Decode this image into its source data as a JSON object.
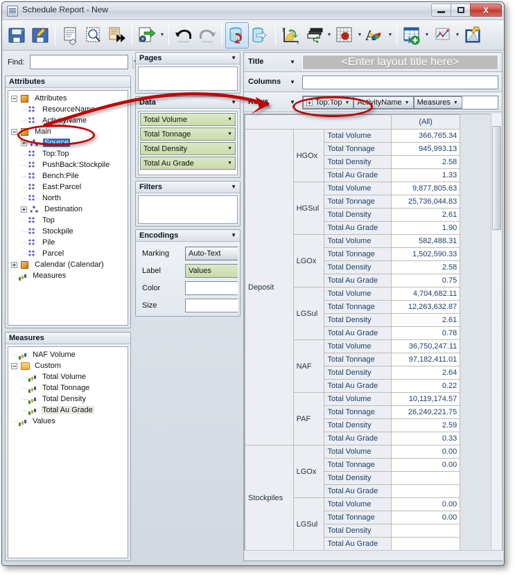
{
  "window": {
    "title": "Schedule Report - New",
    "app_icon": "report-window-icon",
    "minimize_label": "Minimize",
    "maximize_label": "Maximize",
    "close_label": "X"
  },
  "toolbar": {
    "buttons": [
      {
        "name": "save-icon",
        "label": "Save"
      },
      {
        "name": "save-as-icon",
        "label": "Save As"
      },
      {
        "name": "sep1",
        "label": ""
      },
      {
        "name": "clear-layout-icon",
        "label": "Clear Layout"
      },
      {
        "name": "preview-icon",
        "label": "Print Preview"
      },
      {
        "name": "export-sheet-icon",
        "label": "Export Sheet"
      },
      {
        "name": "sep2",
        "label": ""
      },
      {
        "name": "export-settings-icon",
        "label": "Export Settings"
      },
      {
        "name": "sep3",
        "label": ""
      },
      {
        "name": "undo-icon",
        "label": "Undo"
      },
      {
        "name": "redo-icon",
        "label": "Redo"
      },
      {
        "name": "sep4",
        "label": ""
      },
      {
        "name": "refresh-data-icon",
        "label": "Refresh Data"
      },
      {
        "name": "export-data-icon",
        "label": "Export Data"
      },
      {
        "name": "sep5",
        "label": ""
      },
      {
        "name": "axis-settings-icon",
        "label": "Axis Settings"
      },
      {
        "name": "layers-icon",
        "label": "Layers"
      },
      {
        "name": "grid-settings-icon",
        "label": "Grid Settings"
      },
      {
        "name": "font-color-icon",
        "label": "Font and Color"
      },
      {
        "name": "sep6",
        "label": ""
      },
      {
        "name": "add-table-icon",
        "label": "Add Table"
      },
      {
        "name": "add-chart-icon",
        "label": "Add Chart"
      },
      {
        "name": "new-layout-icon",
        "label": "New Layout"
      }
    ]
  },
  "find": {
    "label": "Find:",
    "value": "",
    "placeholder": ""
  },
  "attributes_panel": {
    "title": "Attributes",
    "nodes": [
      {
        "label": "Attributes",
        "depth": 0,
        "expander": "minus",
        "icon": "cube-icon",
        "state": "normal"
      },
      {
        "label": "ResourceName",
        "depth": 1,
        "expander": "leaf",
        "icon": "attribute-icon",
        "state": "normal"
      },
      {
        "label": "ActivityName",
        "depth": 1,
        "expander": "leaf",
        "icon": "attribute-icon",
        "state": "normal"
      },
      {
        "label": "Main",
        "depth": 0,
        "expander": "minus",
        "icon": "cube-icon",
        "state": "normal"
      },
      {
        "label": "Source",
        "depth": 1,
        "expander": "plus",
        "icon": "hierarchy-icon",
        "state": "selected"
      },
      {
        "label": "Top:Top",
        "depth": 1,
        "expander": "leaf",
        "icon": "attribute-icon",
        "state": "normal"
      },
      {
        "label": "PushBack:Stockpile",
        "depth": 1,
        "expander": "leaf",
        "icon": "attribute-icon",
        "state": "normal"
      },
      {
        "label": "Bench:Pile",
        "depth": 1,
        "expander": "leaf",
        "icon": "attribute-icon",
        "state": "normal"
      },
      {
        "label": "East:Parcel",
        "depth": 1,
        "expander": "leaf",
        "icon": "attribute-icon",
        "state": "normal"
      },
      {
        "label": "North",
        "depth": 1,
        "expander": "leaf",
        "icon": "attribute-icon",
        "state": "normal"
      },
      {
        "label": "Destination",
        "depth": 1,
        "expander": "plus",
        "icon": "hierarchy-icon",
        "state": "normal"
      },
      {
        "label": "Top",
        "depth": 1,
        "expander": "leaf",
        "icon": "attribute-icon",
        "state": "normal"
      },
      {
        "label": "Stockpile",
        "depth": 1,
        "expander": "leaf",
        "icon": "attribute-icon",
        "state": "normal"
      },
      {
        "label": "Pile",
        "depth": 1,
        "expander": "leaf",
        "icon": "attribute-icon",
        "state": "normal"
      },
      {
        "label": "Parcel",
        "depth": 1,
        "expander": "leaf",
        "icon": "attribute-icon",
        "state": "normal"
      },
      {
        "label": "Calendar (Calendar)",
        "depth": 0,
        "expander": "plus",
        "icon": "cube-icon",
        "state": "normal"
      },
      {
        "label": "Measures",
        "depth": 0,
        "expander": "leaf",
        "icon": "measures-icon",
        "state": "normal"
      }
    ]
  },
  "measures_panel": {
    "title": "Measures",
    "nodes": [
      {
        "label": "NAF Volume",
        "depth": 0,
        "expander": "leaf",
        "icon": "measure-icon",
        "state": "normal"
      },
      {
        "label": "Custom",
        "depth": 0,
        "expander": "minus",
        "icon": "folder-icon",
        "state": "normal"
      },
      {
        "label": "Total Volume",
        "depth": 1,
        "expander": "leaf",
        "icon": "measure-icon",
        "state": "normal"
      },
      {
        "label": "Total Tonnage",
        "depth": 1,
        "expander": "leaf",
        "icon": "measure-icon",
        "state": "normal"
      },
      {
        "label": "Total Density",
        "depth": 1,
        "expander": "leaf",
        "icon": "calc-measure-icon",
        "state": "normal"
      },
      {
        "label": "Total Au Grade",
        "depth": 1,
        "expander": "leaf",
        "icon": "calc-measure-icon",
        "state": "highlighted"
      },
      {
        "label": "Values",
        "depth": 0,
        "expander": "leaf",
        "icon": "measure-icon",
        "state": "normal"
      }
    ]
  },
  "pages_panel": {
    "title": "Pages",
    "collapse_icon": "chevron-down-icon",
    "items": []
  },
  "data_panel": {
    "title": "Data",
    "collapse_icon": "chevron-down-icon",
    "items": [
      {
        "label": "Total Volume",
        "dropdown_icon": "chevron-down-icon"
      },
      {
        "label": "Total Tonnage",
        "dropdown_icon": "chevron-down-icon"
      },
      {
        "label": "Total Density",
        "dropdown_icon": "chevron-down-icon"
      },
      {
        "label": "Total Au Grade",
        "dropdown_icon": "chevron-down-icon"
      }
    ]
  },
  "filters_panel": {
    "title": "Filters",
    "collapse_icon": "chevron-down-icon",
    "items": []
  },
  "encodings_panel": {
    "title": "Encodings",
    "collapse_icon": "chevron-down-icon",
    "rows": [
      {
        "label": "Marking",
        "value": "Auto-Text",
        "style": "button",
        "dropdown_icon": "chevron-down-icon"
      },
      {
        "label": "Label",
        "value": "Values",
        "style": "green",
        "dropdown_icon": "chevron-down-icon"
      },
      {
        "label": "Color",
        "value": "",
        "style": "empty",
        "dropdown_icon": ""
      },
      {
        "label": "Size",
        "value": "",
        "style": "empty",
        "dropdown_icon": ""
      }
    ]
  },
  "shelves": {
    "title": {
      "label": "Title",
      "collapse_icon": "chevron-down-icon",
      "placeholder": "<Enter layout title here>"
    },
    "columns": {
      "label": "Columns",
      "collapse_icon": "chevron-down-icon",
      "pills": []
    },
    "rows": {
      "label": "Rows",
      "collapse_icon": "chevron-down-icon",
      "pills": [
        {
          "label": "Top:Top",
          "expandable": true,
          "dropdown_icon": "chevron-down-icon"
        },
        {
          "label": "ActivityName",
          "expandable": false,
          "dropdown_icon": "chevron-down-icon"
        },
        {
          "label": "Measures",
          "expandable": false,
          "dropdown_icon": "chevron-down-icon"
        }
      ]
    }
  },
  "pivot": {
    "column_header": "(All)",
    "measures": [
      "Total Volume",
      "Total Tonnage",
      "Total Density",
      "Total Au Grade"
    ],
    "groups": [
      {
        "name": "Deposit",
        "subgroups": [
          {
            "name": "HGOx",
            "values": [
              "366,765.34",
              "945,993.13",
              "2.58",
              "1.33"
            ]
          },
          {
            "name": "HGSul",
            "values": [
              "9,877,805.63",
              "25,736,044.83",
              "2.61",
              "1.90"
            ]
          },
          {
            "name": "LGOx",
            "values": [
              "582,488.31",
              "1,502,590.33",
              "2.58",
              "0.75"
            ]
          },
          {
            "name": "LGSul",
            "values": [
              "4,704,682.11",
              "12,263,632.87",
              "2.61",
              "0.78"
            ]
          },
          {
            "name": "NAF",
            "values": [
              "36,750,247.11",
              "97,182,411.01",
              "2.64",
              "0.22"
            ]
          },
          {
            "name": "PAF",
            "values": [
              "10,119,174.57",
              "26,240,221.75",
              "2.59",
              "0.33"
            ]
          }
        ]
      },
      {
        "name": "Stockpiles",
        "subgroups": [
          {
            "name": "LGOx",
            "values": [
              "0.00",
              "0.00",
              "",
              ""
            ]
          },
          {
            "name": "LGSul",
            "values": [
              "0.00",
              "0.00",
              "",
              ""
            ]
          }
        ]
      }
    ]
  },
  "annotations": {
    "color": "#c00000",
    "ellipse_source": "highlight-source-node",
    "ellipse_rows_pill": "highlight-rows-top-pill",
    "arrow": "arrow-source-to-rows"
  },
  "scrollbars": {
    "vertical_thumb_label": "vertical-scroll-thumb",
    "horizontal_label": "horizontal-scrollbar"
  }
}
